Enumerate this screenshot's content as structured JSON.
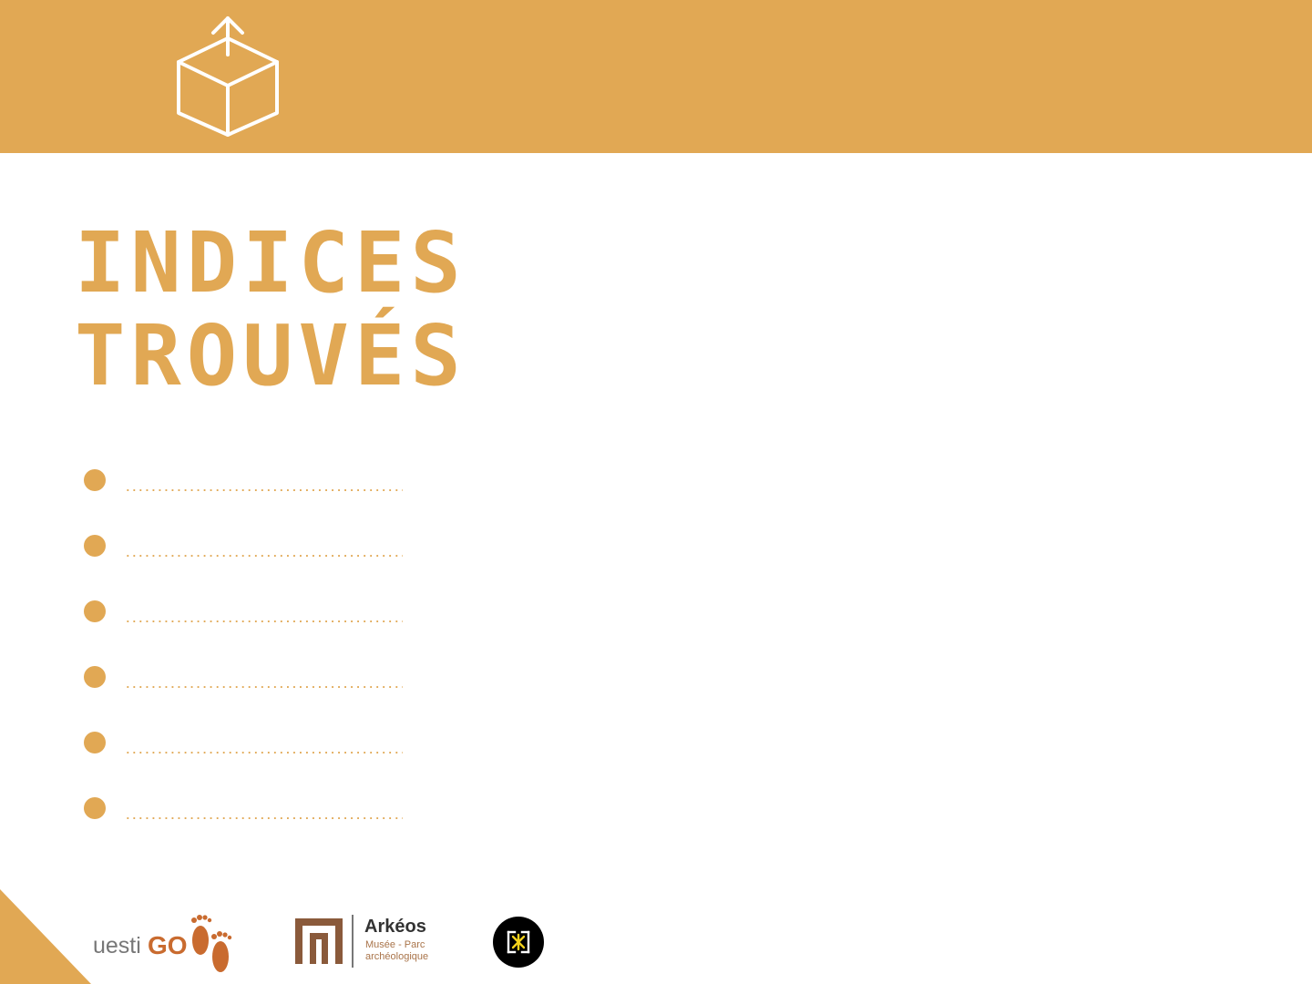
{
  "header": {
    "icon": "box-upload-icon",
    "color": "#e1a854"
  },
  "title": {
    "line1": "INDICES",
    "line2": "TROUVÉS"
  },
  "clues": [
    {
      "placeholder": ".............................................."
    },
    {
      "placeholder": ".............................................."
    },
    {
      "placeholder": ".............................................."
    },
    {
      "placeholder": ".............................................."
    },
    {
      "placeholder": ".............................................."
    },
    {
      "placeholder": ".............................................."
    }
  ],
  "logos": {
    "questigo": {
      "light": "uesti",
      "bold": "GO"
    },
    "arkeos": {
      "name": "Arkéos",
      "sub1": "Musée - Parc",
      "sub2": "archéologique"
    },
    "badge": {
      "icon": "museum-emblem-icon"
    }
  },
  "colors": {
    "accent": "#e1a854",
    "questigo_orange": "#c96b2f"
  }
}
